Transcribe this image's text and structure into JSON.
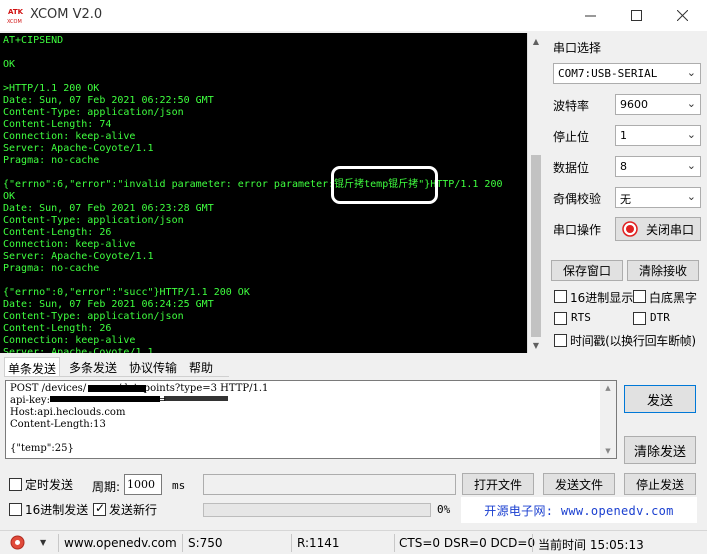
{
  "window": {
    "title": "XCOM V2.0",
    "logo_text": "ATK\nXCOM"
  },
  "terminal": {
    "lines": [
      "AT+CIPSEND",
      "",
      "OK",
      "",
      ">HTTP/1.1 200 OK",
      "Date: Sun, 07 Feb 2021 06:22:50 GMT",
      "Content-Type: application/json",
      "Content-Length: 74",
      "Connection: keep-alive",
      "Server: Apache-Coyote/1.1",
      "Pragma: no-cache",
      "",
      "{\"errno\":6,\"error\":\"invalid parameter: error parameter:锟斤拷temp锟斤拷\"}HTTP/1.1 200",
      "OK",
      "Date: Sun, 07 Feb 2021 06:23:28 GMT",
      "Content-Type: application/json",
      "Content-Length: 26",
      "Connection: keep-alive",
      "Server: Apache-Coyote/1.1",
      "Pragma: no-cache",
      "",
      "{\"errno\":0,\"error\":\"succ\"}HTTP/1.1 200 OK",
      "Date: Sun, 07 Feb 2021 06:24:25 GMT",
      "Content-Type: application/json",
      "Content-Length: 26",
      "Connection: keep-alive",
      "Server: Apache-Coyote/1.1"
    ]
  },
  "panel": {
    "port_select_label": "串口选择",
    "port_value": "COM7:USB-SERIAL",
    "baud_label": "波特率",
    "baud_value": "9600",
    "stop_label": "停止位",
    "stop_value": "1",
    "data_label": "数据位",
    "data_value": "8",
    "parity_label": "奇偶校验",
    "parity_value": "无",
    "op_label": "串口操作",
    "close_port_label": "关闭串口",
    "save_window_label": "保存窗口",
    "clear_recv_label": "清除接收",
    "hex_display_label": "16进制显示",
    "white_bg_label": "白底黑字",
    "rts_label": "RTS",
    "dtr_label": "DTR",
    "timestamp_label": "时间戳(以换行回车断帧)"
  },
  "tabs": [
    "单条发送",
    "多条发送",
    "协议传输",
    "帮助"
  ],
  "send": {
    "lines": [
      "POST /devices/",
      "api-key:",
      "Host:api.heclouds.com",
      "Content-Length:13",
      "",
      "{\"temp\":25}"
    ],
    "line1_tail": "/datapoints?type=3 HTTP/1.1",
    "line2_tail": "=",
    "send_button": "发送",
    "clear_send_button": "清除发送"
  },
  "bottom": {
    "timed_send_label": "定时发送",
    "period_label": "周期:",
    "period_value": "1000",
    "period_unit": "ms",
    "hex_send_label": "16进制发送",
    "send_newline_label": "发送新行",
    "progress_text": "0%",
    "open_file_button": "打开文件",
    "send_file_button": "发送文件",
    "stop_send_button": "停止发送",
    "site_banner": "开源电子网: www.openedv.com"
  },
  "status": {
    "url": "www.openedv.com",
    "sent": "S:750",
    "received": "R:1141",
    "signals": "CTS=0 DSR=0 DCD=0",
    "time": "当前时间 15:05:13"
  },
  "colors": {
    "terminal_bg": "#000000",
    "terminal_fg": "#3fff3f",
    "banner_fg": "#1a3fd0",
    "close_port_icon": "#e02020"
  }
}
